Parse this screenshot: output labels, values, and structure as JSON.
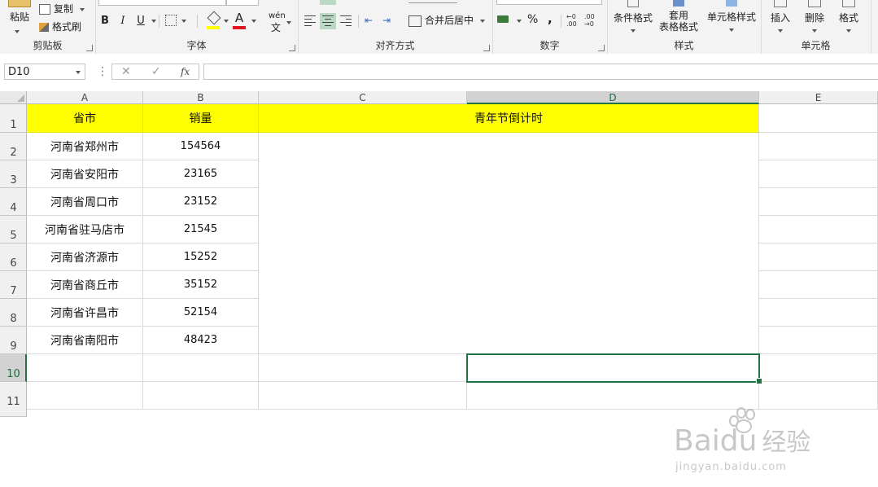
{
  "ribbon": {
    "clipboard": {
      "paste_label": "粘贴",
      "copy_label": "复制",
      "format_painter_label": "格式刷",
      "group_label": "剪贴板"
    },
    "font": {
      "bold": "B",
      "italic": "I",
      "underline": "U",
      "wen": "wén",
      "font_color_letter": "A",
      "group_label": "字体"
    },
    "alignment": {
      "merge_label": "合并后居中",
      "group_label": "对齐方式"
    },
    "number": {
      "percent": "%",
      "comma": ",",
      "group_label": "数字"
    },
    "styles": {
      "conditional_label": "条件格式",
      "table_format_label_1": "套用",
      "table_format_label_2": "表格格式",
      "cell_styles_label": "单元格样式",
      "group_label": "样式"
    },
    "cells": {
      "insert_label": "插入",
      "delete_label": "删除",
      "format_label": "格式",
      "group_label": "单元格"
    }
  },
  "formula_bar": {
    "name_box": "D10",
    "cancel_icon": "✕",
    "enter_icon": "✓",
    "fx_label": "fx",
    "formula": ""
  },
  "columns": [
    "A",
    "B",
    "C",
    "D",
    "E"
  ],
  "active_column": "D",
  "rows": [
    "1",
    "2",
    "3",
    "4",
    "5",
    "6",
    "7",
    "8",
    "9",
    "10",
    "11"
  ],
  "active_row": "10",
  "header": {
    "province": "省市",
    "sales": "销量",
    "countdown": "青年节倒计时"
  },
  "data_rows": [
    {
      "province": "河南省郑州市",
      "sales": "154564"
    },
    {
      "province": "河南省安阳市",
      "sales": "23165"
    },
    {
      "province": "河南省周口市",
      "sales": "23152"
    },
    {
      "province": "河南省驻马店市",
      "sales": "21545"
    },
    {
      "province": "河南省济源市",
      "sales": "15252"
    },
    {
      "province": "河南省商丘市",
      "sales": "35152"
    },
    {
      "province": "河南省许昌市",
      "sales": "52154"
    },
    {
      "province": "河南省南阳市",
      "sales": "48423"
    }
  ],
  "colors": {
    "header_fill": "#ffff00",
    "selection": "#217346"
  },
  "watermark": {
    "brand_top": "Bai",
    "brand_mark": "du",
    "brand_cn": "经验",
    "url": "jingyan.baidu.com"
  }
}
